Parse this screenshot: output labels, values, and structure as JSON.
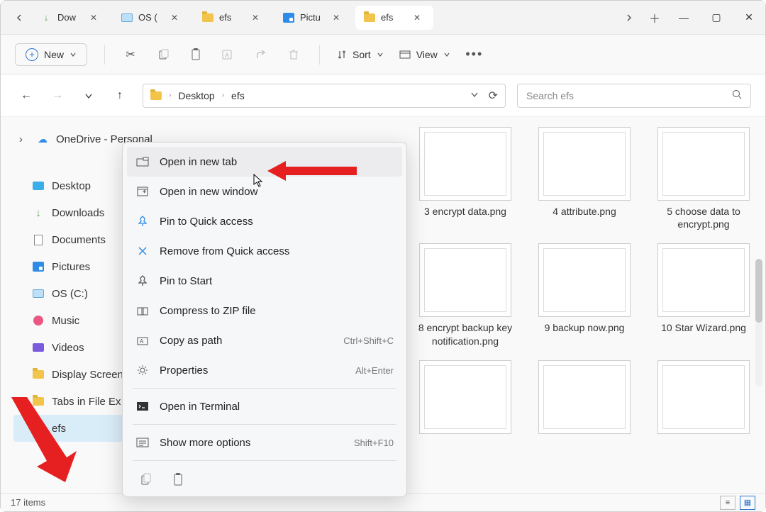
{
  "titlebar": {
    "tabs": [
      {
        "label": "Dow",
        "kind": "downloads"
      },
      {
        "label": "OS (",
        "kind": "disk"
      },
      {
        "label": "efs",
        "kind": "folder"
      },
      {
        "label": "Pictu",
        "kind": "picture"
      },
      {
        "label": "efs",
        "kind": "folder",
        "active": true
      }
    ]
  },
  "toolbar": {
    "new_label": "New",
    "sort_label": "Sort",
    "view_label": "View"
  },
  "breadcrumbs": [
    "Desktop",
    "efs"
  ],
  "search": {
    "placeholder": "Search efs"
  },
  "sidebar": {
    "onedrive": "OneDrive - Personal",
    "quick": [
      "Desktop",
      "Downloads",
      "Documents",
      "Pictures",
      "OS (C:)",
      "Music",
      "Videos",
      "Display Screen",
      "Tabs in File Ex",
      "efs"
    ]
  },
  "files": [
    "3 encrypt data.png",
    "4 attribute.png",
    "5 choose data to encrypt.png",
    "8 encrypt backup key notification.png",
    "9 backup now.png",
    "10 Star Wizard.png",
    "",
    "",
    ""
  ],
  "context_menu": {
    "items": [
      {
        "icon": "open-tab-icon",
        "label": "Open in new tab",
        "hover": true
      },
      {
        "icon": "open-window-icon",
        "label": "Open in new window"
      },
      {
        "icon": "pin-icon",
        "label": "Pin to Quick access"
      },
      {
        "icon": "unpin-icon",
        "label": "Remove from Quick access"
      },
      {
        "icon": "pin-start-icon",
        "label": "Pin to Start"
      },
      {
        "icon": "zip-icon",
        "label": "Compress to ZIP file"
      },
      {
        "icon": "copy-path-icon",
        "label": "Copy as path",
        "shortcut": "Ctrl+Shift+C"
      },
      {
        "icon": "properties-icon",
        "label": "Properties",
        "shortcut": "Alt+Enter"
      },
      {
        "sep": true
      },
      {
        "icon": "terminal-icon",
        "label": "Open in Terminal"
      },
      {
        "sep": true
      },
      {
        "icon": "more-icon",
        "label": "Show more options",
        "shortcut": "Shift+F10"
      }
    ]
  },
  "statusbar": {
    "count": "17 items"
  }
}
